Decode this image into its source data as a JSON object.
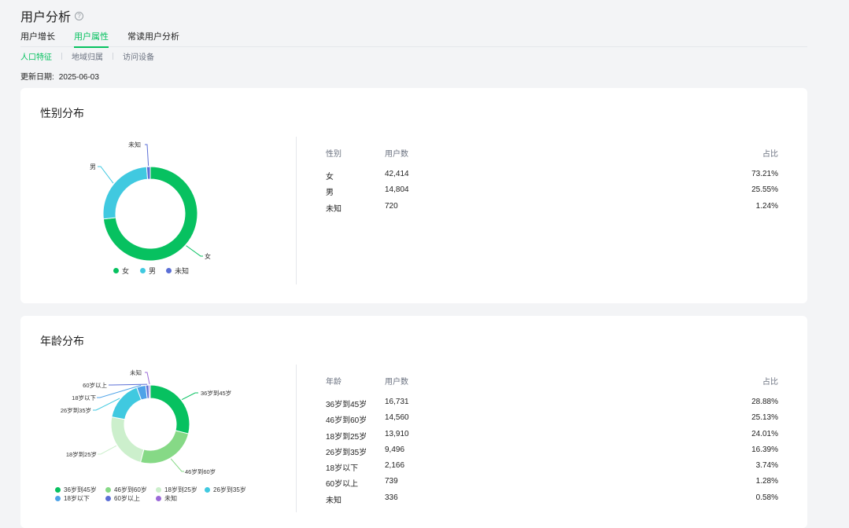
{
  "header": {
    "title": "用户分析",
    "help_icon": "question-circle-icon"
  },
  "tabs": [
    {
      "label": "用户增长",
      "active": false
    },
    {
      "label": "用户属性",
      "active": true
    },
    {
      "label": "常读用户分析",
      "active": false
    }
  ],
  "subtabs": [
    {
      "label": "人口特征",
      "active": true
    },
    {
      "label": "地域归属",
      "active": false
    },
    {
      "label": "访问设备",
      "active": false
    }
  ],
  "update": {
    "label": "更新日期:",
    "value": "2025-06-03"
  },
  "colors": {
    "accent": "#07c160"
  },
  "gender": {
    "title": "性别分布",
    "headers": [
      "性别",
      "用户数",
      "占比"
    ],
    "rows": [
      {
        "name": "女",
        "count": "42,414",
        "pct": "73.21%"
      },
      {
        "name": "男",
        "count": "14,804",
        "pct": "25.55%"
      },
      {
        "name": "未知",
        "count": "720",
        "pct": "1.24%"
      }
    ],
    "legend": [
      "女",
      "男",
      "未知"
    ]
  },
  "age": {
    "title": "年龄分布",
    "headers": [
      "年龄",
      "用户数",
      "占比"
    ],
    "rows": [
      {
        "name": "36岁到45岁",
        "count": "16,731",
        "pct": "28.88%"
      },
      {
        "name": "46岁到60岁",
        "count": "14,560",
        "pct": "25.13%"
      },
      {
        "name": "18岁到25岁",
        "count": "13,910",
        "pct": "24.01%"
      },
      {
        "name": "26岁到35岁",
        "count": "9,496",
        "pct": "16.39%"
      },
      {
        "name": "18岁以下",
        "count": "2,166",
        "pct": "3.74%"
      },
      {
        "name": "60岁以上",
        "count": "739",
        "pct": "1.28%"
      },
      {
        "name": "未知",
        "count": "336",
        "pct": "0.58%"
      }
    ],
    "legend": [
      "36岁到45岁",
      "46岁到60岁",
      "18岁到25岁",
      "26岁到35岁",
      "18岁以下",
      "60岁以上",
      "未知"
    ]
  },
  "chart_data": [
    {
      "type": "pie",
      "categories": [
        "女",
        "男",
        "未知"
      ],
      "values": [
        73.21,
        25.55,
        1.24
      ],
      "colors": [
        "#07c160",
        "#40c9e0",
        "#5b6fd6"
      ]
    },
    {
      "type": "pie",
      "categories": [
        "36岁到45岁",
        "46岁到60岁",
        "18岁到25岁",
        "26岁到35岁",
        "18岁以下",
        "60岁以上",
        "未知"
      ],
      "values": [
        28.88,
        25.13,
        24.01,
        16.39,
        3.74,
        1.28,
        0.58
      ],
      "colors": [
        "#07c160",
        "#86d986",
        "#ccefcc",
        "#40c9e0",
        "#4ea3e8",
        "#5b6fd6",
        "#9b6ad8"
      ]
    }
  ]
}
